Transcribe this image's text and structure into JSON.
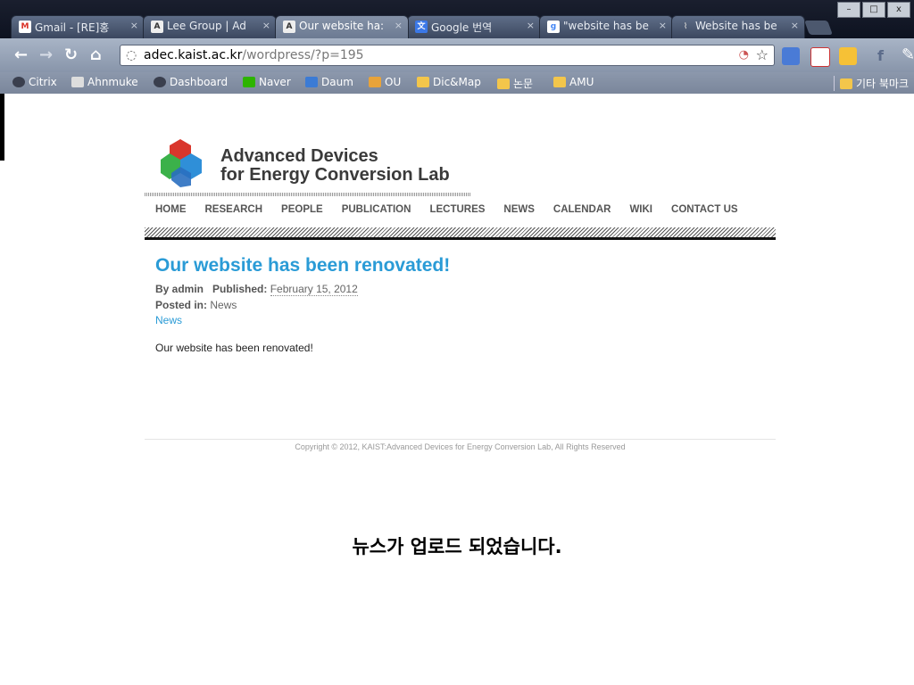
{
  "browser": {
    "tabs": [
      {
        "label": "Gmail - [RE]홍",
        "icon": "gmail-icon",
        "color": "#d93025"
      },
      {
        "label": "Lee Group | Ad",
        "icon": "site-a-icon",
        "color": "#333333"
      },
      {
        "label": "Our website ha:",
        "icon": "site-a-icon",
        "color": "#333333",
        "active": true
      },
      {
        "label": "Google 번역",
        "icon": "translate-icon",
        "color": "#3b78e7"
      },
      {
        "label": "\"website has be",
        "icon": "google-icon",
        "color": "#4285f4"
      },
      {
        "label": "Website has be",
        "icon": "paperclip-icon",
        "color": "#888888"
      }
    ],
    "close_glyph": "×",
    "window_buttons": [
      "–",
      "□",
      "x"
    ],
    "url_host": "adec.kaist.ac.kr",
    "url_path": "/wordpress/?p=195",
    "bookmarks": [
      {
        "label": "Citrix",
        "icon": "citrix-icon"
      },
      {
        "label": "Ahnmuke",
        "icon": "ahnmuke-icon"
      },
      {
        "label": "Dashboard",
        "icon": "dashboard-icon"
      },
      {
        "label": "Naver",
        "icon": "naver-icon"
      },
      {
        "label": "Daum",
        "icon": "daum-icon"
      },
      {
        "label": "OU",
        "icon": "ou-icon"
      },
      {
        "label": "Dic&Map",
        "icon": "folder-icon"
      },
      {
        "label": "논문",
        "icon": "folder-icon"
      },
      {
        "label": "AMU",
        "icon": "folder-icon"
      }
    ],
    "other_bookmarks": "기타 북마크"
  },
  "site": {
    "logo_line1": "Advanced Devices",
    "logo_line2": "for Energy Conversion Lab",
    "menu": [
      "HOME",
      "RESEARCH",
      "PEOPLE",
      "PUBLICATION",
      "LECTURES",
      "NEWS",
      "CALENDAR",
      "WIKI",
      "CONTACT US"
    ]
  },
  "post": {
    "title": "Our website has been renovated!",
    "by_label": "By admin",
    "published_label": "Published:",
    "date": "February 15, 2012",
    "posted_in_label": "Posted in:",
    "category": "News",
    "category_link": "News",
    "body": "Our website has been renovated!"
  },
  "footer": {
    "copyright": "Copyright © 2012, KAIST:Advanced Devices for Energy Conversion Lab, All Rights Reserved"
  },
  "caption": "뉴스가 업로드 되었습니다."
}
